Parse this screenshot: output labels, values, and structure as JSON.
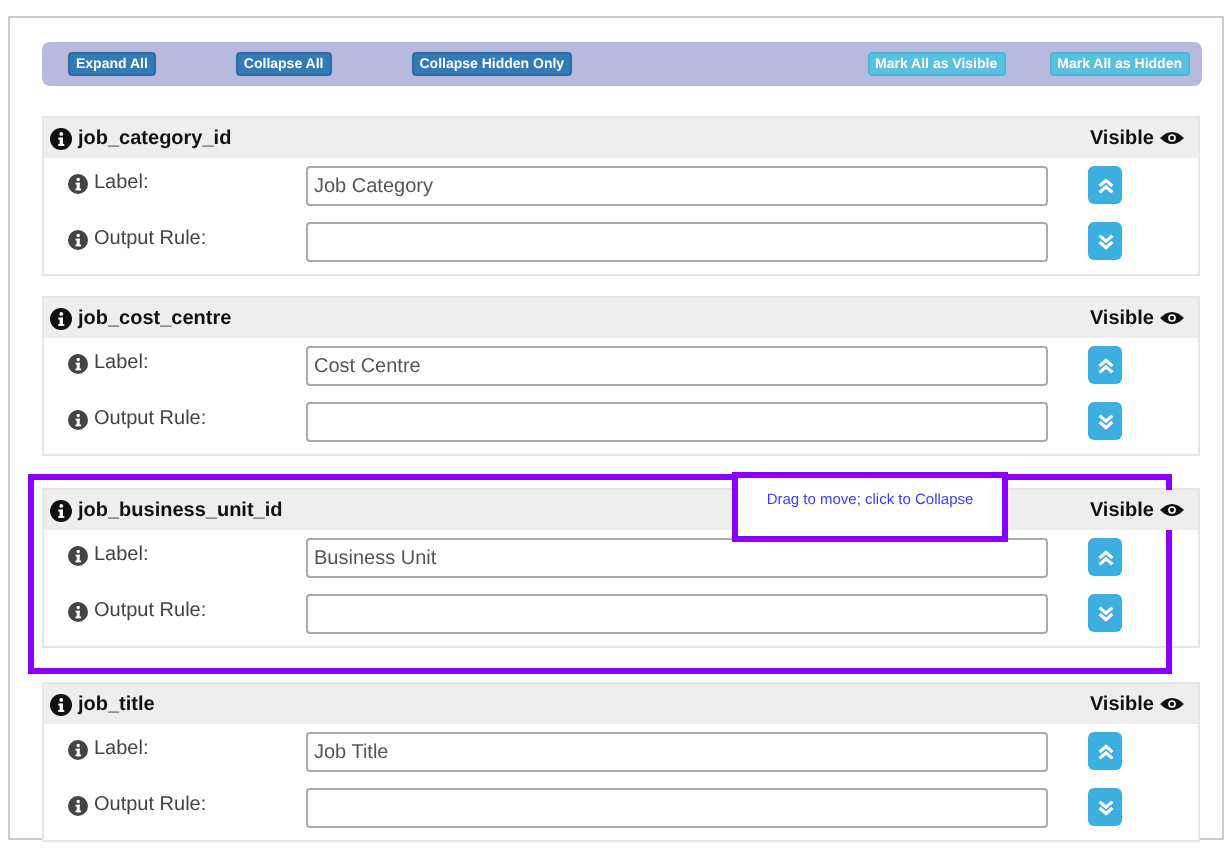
{
  "toolbar": {
    "buttons": [
      {
        "label": "Expand All",
        "kind": "primary"
      },
      {
        "label": "Collapse All",
        "kind": "primary"
      },
      {
        "label": "Collapse Hidden Only",
        "kind": "primary"
      },
      {
        "label": "Mark All as Visible",
        "kind": "info"
      },
      {
        "label": "Mark All as Hidden",
        "kind": "info"
      }
    ]
  },
  "fields": [
    {
      "name": "job_category_id",
      "visibility": "Visible",
      "highlighted": false,
      "label_caption": "Label:",
      "label_value": "Job Category",
      "rule_caption": "Output Rule:"
    },
    {
      "name": "job_cost_centre",
      "visibility": "Visible",
      "highlighted": false,
      "label_caption": "Label:",
      "label_value": "Cost Centre",
      "rule_caption": "Output Rule:"
    },
    {
      "name": "job_business_unit_id",
      "visibility": "Visible",
      "highlighted": true,
      "tooltip": "Drag to move; click to Collapse",
      "label_caption": "Label:",
      "label_value": "Business Unit",
      "rule_caption": "Output Rule:"
    },
    {
      "name": "job_title",
      "visibility": "Visible",
      "highlighted": false,
      "label_caption": "Label:",
      "label_value": "Job Title",
      "rule_caption": "Output Rule:"
    }
  ]
}
